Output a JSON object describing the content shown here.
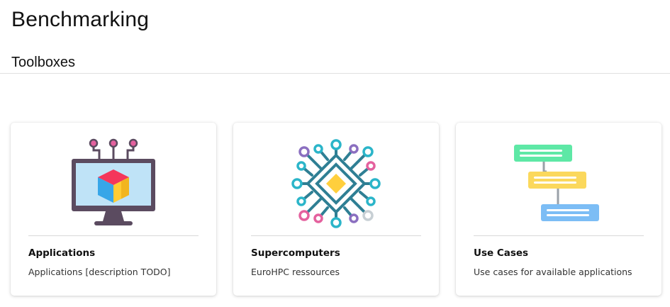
{
  "page": {
    "title": "Benchmarking"
  },
  "section": {
    "title": "Toolboxes"
  },
  "cards": [
    {
      "title": "Applications",
      "description": "Applications [description TODO]",
      "icon": "monitor-cube-icon"
    },
    {
      "title": "Supercomputers",
      "description": "EuroHPC ressources",
      "icon": "chip-circuit-icon"
    },
    {
      "title": "Use Cases",
      "description": "Use cases for available applications",
      "icon": "flowchart-icon"
    }
  ],
  "colors": {
    "monitor_frame": "#5b4b60",
    "monitor_screen": "#bfe3f7",
    "cube_red": "#f4365b",
    "cube_yellow": "#ffcc33",
    "cube_blue": "#37a6e8",
    "circuit_teal": "#2f7f94",
    "node_purple": "#8b6fc0",
    "node_pink": "#e4619e",
    "node_cyan": "#2bb5c9",
    "node_grey": "#c7cfd4",
    "chip_yellow": "#ffcf3d",
    "flow_green": "#5ee8a6",
    "flow_yellow": "#fbd85c",
    "flow_blue": "#7cbdf5",
    "flow_line": "#9aa1a8"
  }
}
